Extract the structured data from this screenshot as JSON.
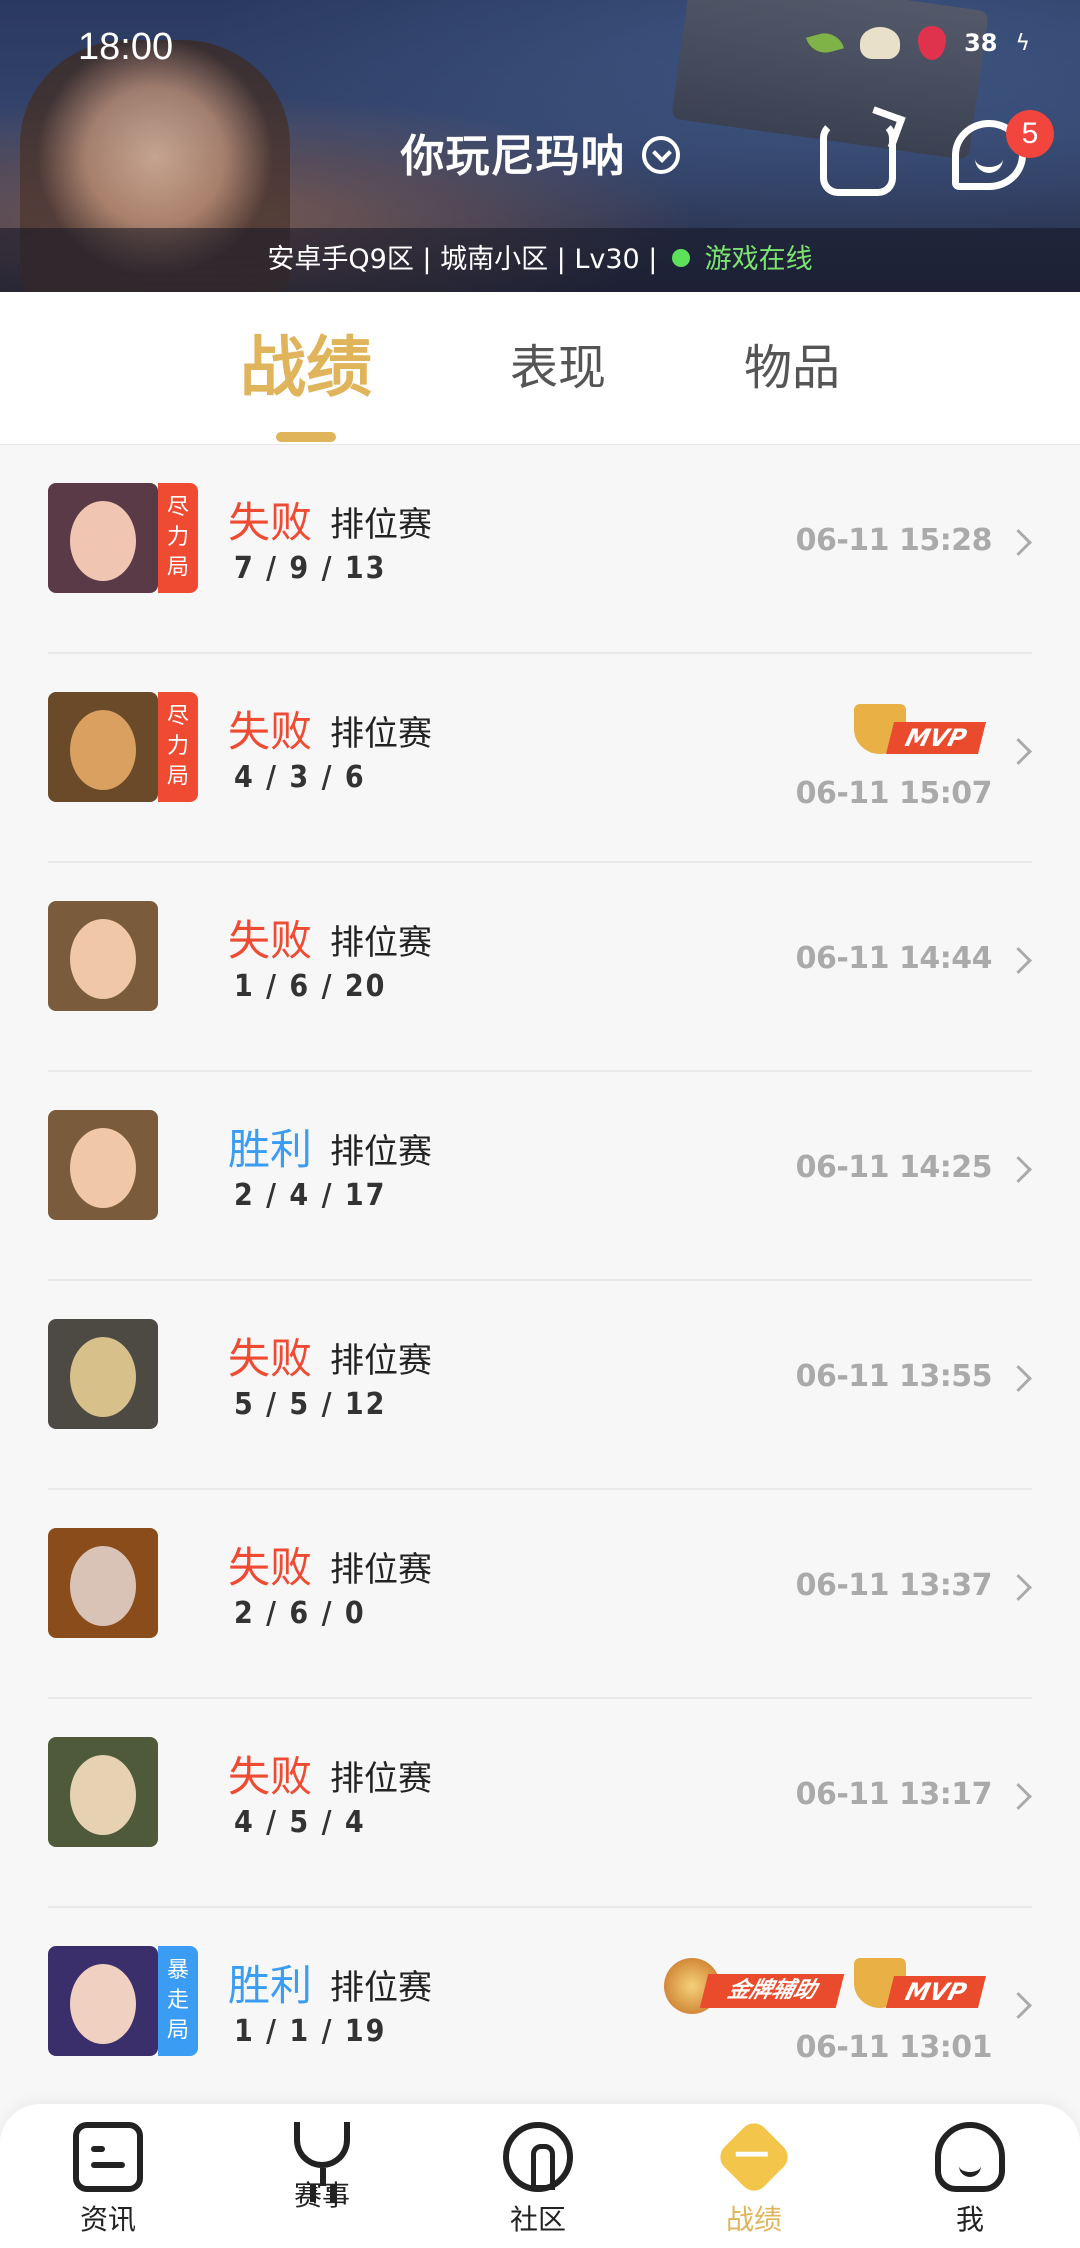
{
  "status_bar": {
    "time": "18:00",
    "battery": "38"
  },
  "header": {
    "player_name": "你玩尼玛呐",
    "chat_badge": "5",
    "info_prefix": "安卓手Q9区 | 城南小区 | Lv30 |",
    "online_status": "游戏在线"
  },
  "tabs": [
    "战绩",
    "表现",
    "物品"
  ],
  "matches": [
    {
      "result": "失败",
      "type": "loss",
      "mode": "排位赛",
      "kda": "7 / 9 / 13",
      "time": "06-11 15:28",
      "tag": "尽力局",
      "tag_color": "red",
      "mvp": false,
      "gold": false,
      "avatar_bg": "#5a3a46",
      "face": "#f0c6b3"
    },
    {
      "result": "失败",
      "type": "loss",
      "mode": "排位赛",
      "kda": "4 / 3 / 6",
      "time": "06-11 15:07",
      "tag": "尽力局",
      "tag_color": "red",
      "mvp": true,
      "gold": false,
      "avatar_bg": "#6b4a2a",
      "face": "#d9a060"
    },
    {
      "result": "失败",
      "type": "loss",
      "mode": "排位赛",
      "kda": "1 / 6 / 20",
      "time": "06-11 14:44",
      "tag": "",
      "tag_color": "",
      "mvp": false,
      "gold": false,
      "avatar_bg": "#7a5b3c",
      "face": "#f0c8a8"
    },
    {
      "result": "胜利",
      "type": "win",
      "mode": "排位赛",
      "kda": "2 / 4 / 17",
      "time": "06-11 14:25",
      "tag": "",
      "tag_color": "",
      "mvp": false,
      "gold": false,
      "avatar_bg": "#7a5b3c",
      "face": "#f0c8a8"
    },
    {
      "result": "失败",
      "type": "loss",
      "mode": "排位赛",
      "kda": "5 / 5 / 12",
      "time": "06-11 13:55",
      "tag": "",
      "tag_color": "",
      "mvp": false,
      "gold": false,
      "avatar_bg": "#4c4a42",
      "face": "#d8c08a"
    },
    {
      "result": "失败",
      "type": "loss",
      "mode": "排位赛",
      "kda": "2 / 6 / 0",
      "time": "06-11 13:37",
      "tag": "",
      "tag_color": "",
      "mvp": false,
      "gold": false,
      "avatar_bg": "#8a4c1a",
      "face": "#d9c3b6"
    },
    {
      "result": "失败",
      "type": "loss",
      "mode": "排位赛",
      "kda": "4 / 5 / 4",
      "time": "06-11 13:17",
      "tag": "",
      "tag_color": "",
      "mvp": false,
      "gold": false,
      "avatar_bg": "#4e5a3a",
      "face": "#e6d2b2"
    },
    {
      "result": "胜利",
      "type": "win",
      "mode": "排位赛",
      "kda": "1 / 1 / 19",
      "time": "06-11 13:01",
      "tag": "暴走局",
      "tag_color": "blue",
      "mvp": true,
      "gold": true,
      "avatar_bg": "#3a2f6a",
      "face": "#f0d0c0"
    }
  ],
  "badges": {
    "mvp": "MVP",
    "gold": "金牌辅助"
  },
  "bottom_nav": [
    {
      "label": "资讯",
      "icon": "news-icon"
    },
    {
      "label": "赛事",
      "icon": "trophy-icon"
    },
    {
      "label": "社区",
      "icon": "community-icon"
    },
    {
      "label": "战绩",
      "icon": "record-icon",
      "active": true
    },
    {
      "label": "我",
      "icon": "profile-icon"
    }
  ]
}
